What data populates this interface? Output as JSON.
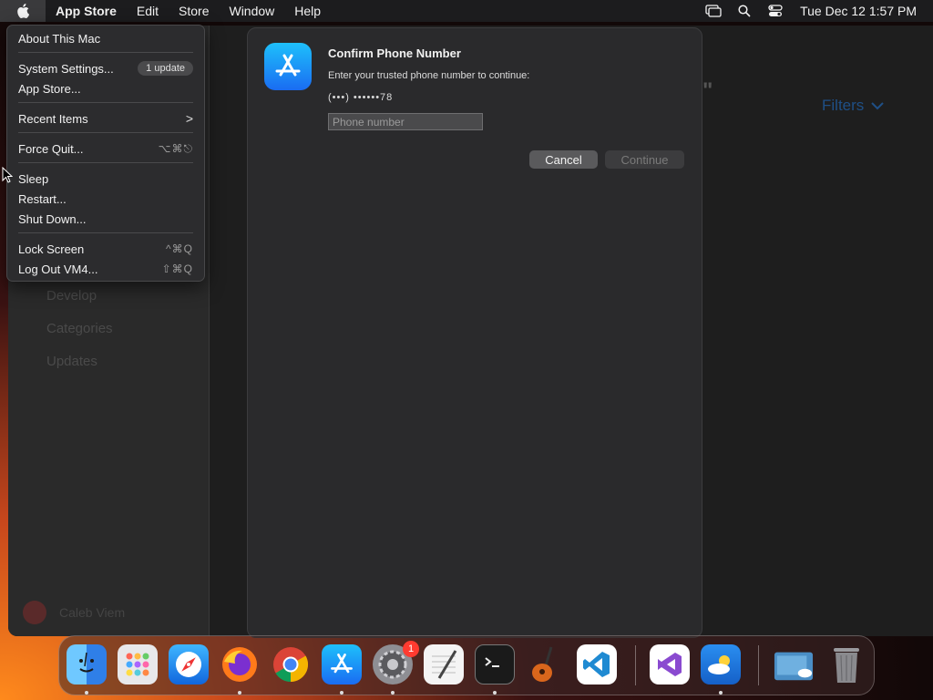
{
  "menubar": {
    "app_name": "App Store",
    "menus": [
      "Edit",
      "Store",
      "Window",
      "Help"
    ],
    "clock": "Tue Dec 12  1:57 PM"
  },
  "apple_menu": {
    "items": [
      {
        "label": "About This Mac",
        "shortcut": ""
      },
      {
        "label": "System Settings...",
        "badge": "1 update"
      },
      {
        "label": "App Store...",
        "shortcut": ""
      },
      {
        "label": "Recent Items",
        "shortcut": ">"
      },
      {
        "label": "Force Quit...",
        "shortcut": "⌥⌘⎋"
      },
      {
        "label": "Sleep",
        "shortcut": ""
      },
      {
        "label": "Restart...",
        "shortcut": ""
      },
      {
        "label": "Shut Down...",
        "shortcut": ""
      },
      {
        "label": "Lock Screen",
        "shortcut": "^⌘Q"
      },
      {
        "label": "Log Out VM4...",
        "shortcut": "⇧⌘Q"
      }
    ]
  },
  "sidebar": {
    "items": [
      "Develop",
      "Categories",
      "Updates"
    ],
    "user": "Caleb Viem"
  },
  "main": {
    "filters_label": "Filters",
    "quote_mark": "\""
  },
  "dialog": {
    "title": "Confirm Phone Number",
    "message": "Enter your trusted phone number to continue:",
    "masked_phone": "(•••) ••••••78",
    "input_placeholder": "Phone number",
    "input_value": "",
    "cancel_label": "Cancel",
    "continue_label": "Continue"
  },
  "dock": {
    "apps": [
      "finder-icon",
      "launchpad-icon",
      "safari-icon",
      "firefox-icon",
      "chrome-icon",
      "app-store-icon",
      "system-settings-icon",
      "textedit-icon",
      "terminal-icon",
      "garageband-icon",
      "vscode-icon",
      "visual-studio-icon",
      "weather-icon",
      "downloads-folder-icon",
      "trash-icon"
    ],
    "system_settings_badge": "1",
    "colors": {
      "accent": "#1a6cf2",
      "badge": "#ff3b30"
    }
  }
}
